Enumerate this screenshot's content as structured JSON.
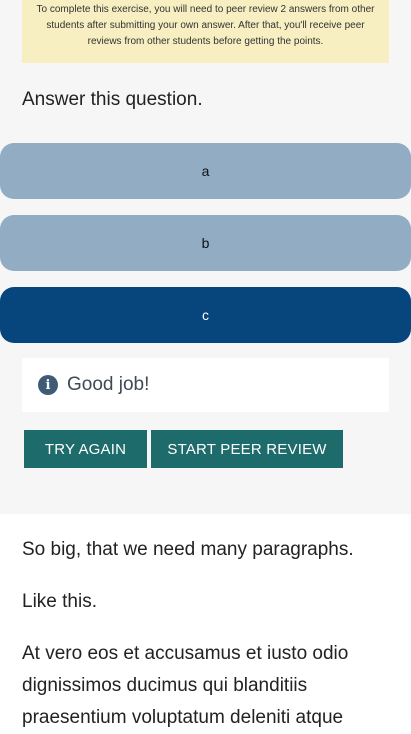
{
  "notice": {
    "text": "To complete this exercise, you will need to peer review 2 answers from other students after submitting your own answer. After that, you'll receive peer reviews from other students before getting the points."
  },
  "question": {
    "prompt": "Answer this question."
  },
  "options": [
    {
      "label": "a",
      "selected": false
    },
    {
      "label": "b",
      "selected": false
    },
    {
      "label": "c",
      "selected": true
    }
  ],
  "feedback": {
    "icon": "info-icon",
    "icon_glyph": "i",
    "message": "Good job!"
  },
  "actions": {
    "try_again_label": "TRY AGAIN",
    "start_peer_review_label": "START PEER REVIEW"
  },
  "content": {
    "paragraphs": [
      "So big, that we need many paragraphs.",
      "Like this.",
      "At vero eos et accusamus et iusto odio dignissimos ducimus qui blanditiis praesentium voluptatum deleniti atque"
    ]
  },
  "colors": {
    "notice_bg": "#f7eec1",
    "option_bg": "#92acc4",
    "option_selected_bg": "#07467d",
    "button_bg": "#1e6b6b"
  }
}
